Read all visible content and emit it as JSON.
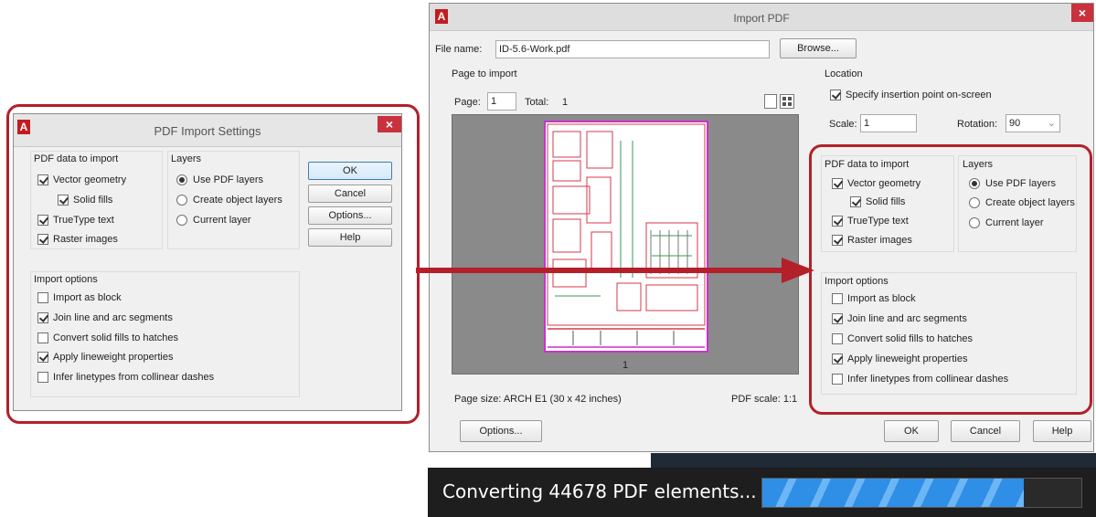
{
  "settings_dialog": {
    "title": "PDF Import Settings",
    "logo": "A",
    "close": "×",
    "pdf_data_heading": "PDF data to import",
    "vector_geometry": "Vector geometry",
    "solid_fills": "Solid fills",
    "truetype_text": "TrueType text",
    "raster_images": "Raster images",
    "layers_heading": "Layers",
    "use_pdf_layers": "Use PDF layers",
    "create_object_layers": "Create object layers",
    "current_layer": "Current layer",
    "ok": "OK",
    "cancel": "Cancel",
    "options": "Options...",
    "help": "Help",
    "import_options_heading": "Import options",
    "import_as_block": "Import as block",
    "join_segments": "Join line and arc segments",
    "convert_fills": "Convert solid fills to hatches",
    "apply_lineweight": "Apply lineweight properties",
    "infer_linetypes": "Infer linetypes from collinear dashes"
  },
  "import_dialog": {
    "title": "Import PDF",
    "logo": "A",
    "close": "×",
    "file_name_label": "File name:",
    "file_name_value": "ID-5.6-Work.pdf",
    "browse": "Browse...",
    "page_to_import": "Page to import",
    "page_label": "Page:",
    "page_value": "1",
    "total_label": "Total:",
    "total_value": "1",
    "thumb_page_number": "1",
    "page_size": "Page size: ARCH E1 (30 x 42 inches)",
    "pdf_scale": "PDF scale: 1:1",
    "location_heading": "Location",
    "specify_insertion": "Specify insertion point on-screen",
    "scale_label": "Scale:",
    "scale_value": "1",
    "rotation_label": "Rotation:",
    "rotation_value": "90",
    "pdf_data_heading": "PDF data to import",
    "vector_geometry": "Vector geometry",
    "solid_fills": "Solid fills",
    "truetype_text": "TrueType text",
    "raster_images": "Raster images",
    "layers_heading": "Layers",
    "use_pdf_layers": "Use PDF layers",
    "create_object_layers": "Create object layers",
    "current_layer": "Current layer",
    "import_options_heading": "Import options",
    "import_as_block": "Import as block",
    "join_segments": "Join line and arc segments",
    "convert_fills": "Convert solid fills to hatches",
    "apply_lineweight": "Apply lineweight properties",
    "infer_linetypes": "Infer linetypes from collinear dashes",
    "options": "Options...",
    "ok": "OK",
    "cancel": "Cancel",
    "help": "Help"
  },
  "progress": {
    "text": "Converting 44678 PDF elements...",
    "fraction": 0.82
  },
  "colors": {
    "highlight": "#b3202a",
    "arrow": "#b3202a",
    "logo": "#c11d21",
    "progress_fill": "#2f8ee5"
  }
}
